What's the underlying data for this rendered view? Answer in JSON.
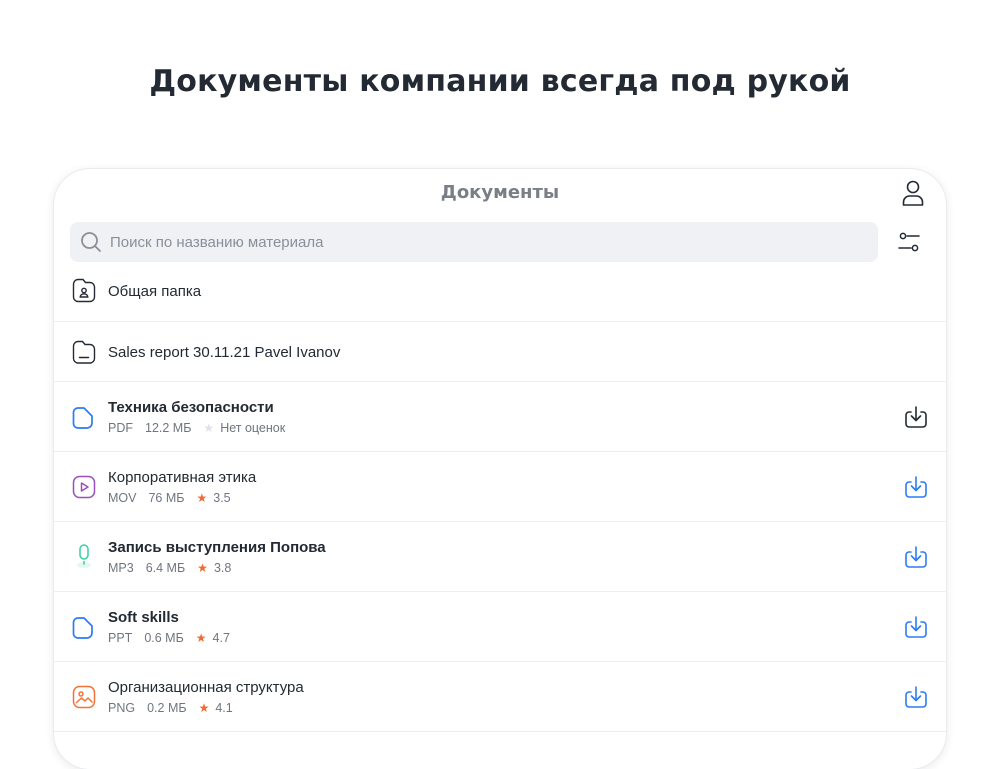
{
  "headline": "Документы компании всегда под рукой",
  "app": {
    "title": "Документы"
  },
  "icons": {
    "profile": "user-icon",
    "filter": "sliders-icon",
    "search": "search-icon",
    "download": "download-icon"
  },
  "search": {
    "placeholder": "Поиск по названию материала",
    "value": ""
  },
  "folders": [
    {
      "name": "Общая папка",
      "icon": "shared-folder-icon"
    },
    {
      "name": "Sales report 30.11.21 Pavel Ivanov",
      "icon": "folder-icon"
    }
  ],
  "files": [
    {
      "name": "Техника безопасности",
      "format": "PDF",
      "size": "12.2 МБ",
      "rating": "Нет оценок",
      "rated": false,
      "bold": true,
      "icon": "document-icon",
      "icon_color": "#2b7bf6",
      "download_color": "#232a33"
    },
    {
      "name": "Корпоративная этика",
      "format": "MOV",
      "size": "76 МБ",
      "rating": "3.5",
      "rated": true,
      "bold": false,
      "icon": "video-icon",
      "icon_color": "#9c4fb8",
      "download_color": "#2b7bf6"
    },
    {
      "name": "Запись выступления Попова",
      "format": "MP3",
      "size": "6.4 МБ",
      "rating": "3.8",
      "rated": true,
      "bold": true,
      "icon": "microphone-icon",
      "icon_color": "#3cd3a5",
      "download_color": "#2b7bf6"
    },
    {
      "name": "Soft skills",
      "format": "PPT",
      "size": "0.6 МБ",
      "rating": "4.7",
      "rated": true,
      "bold": true,
      "icon": "document-icon",
      "icon_color": "#2b7bf6",
      "download_color": "#2b7bf6"
    },
    {
      "name": "Организационная структура",
      "format": "PNG",
      "size": "0.2 МБ",
      "rating": "4.1",
      "rated": true,
      "bold": false,
      "icon": "image-icon",
      "icon_color": "#f0743a",
      "download_color": "#2b7bf6"
    }
  ],
  "colors": {
    "star_active": "#ef6a35",
    "star_inactive": "#dfe2ea",
    "text": "#232a33",
    "muted": "#6f7580"
  }
}
